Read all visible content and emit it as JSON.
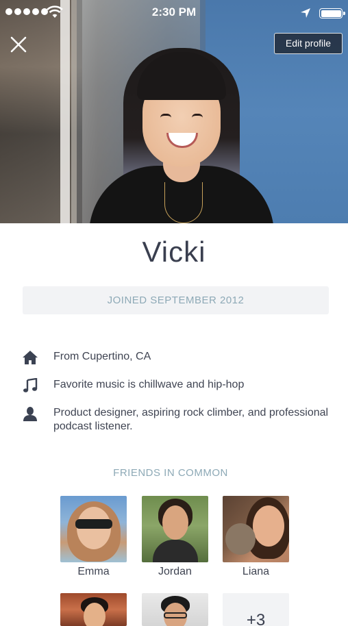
{
  "status_bar": {
    "time": "2:30 PM",
    "signal_dots": 5,
    "battery_level": 1.0
  },
  "header": {
    "close_icon": "close-icon",
    "edit_label": "Edit profile"
  },
  "profile": {
    "name": "Vicki",
    "joined": "JOINED SEPTEMBER 2012",
    "details": [
      {
        "icon": "home-icon",
        "text": "From Cupertino, CA"
      },
      {
        "icon": "music-note-icon",
        "text": "Favorite music is chillwave and hip-hop"
      },
      {
        "icon": "person-icon",
        "text": "Product designer, aspiring rock climber, and professional podcast listener."
      }
    ]
  },
  "friends": {
    "title": "FRIENDS IN COMMON",
    "items": [
      {
        "name": "Emma"
      },
      {
        "name": "Jordan"
      },
      {
        "name": "Liana"
      }
    ],
    "more_label": "+3"
  },
  "colors": {
    "accent_text": "#8da9b6",
    "body_text": "#3f4452",
    "pill_bg": "#f2f3f5"
  }
}
